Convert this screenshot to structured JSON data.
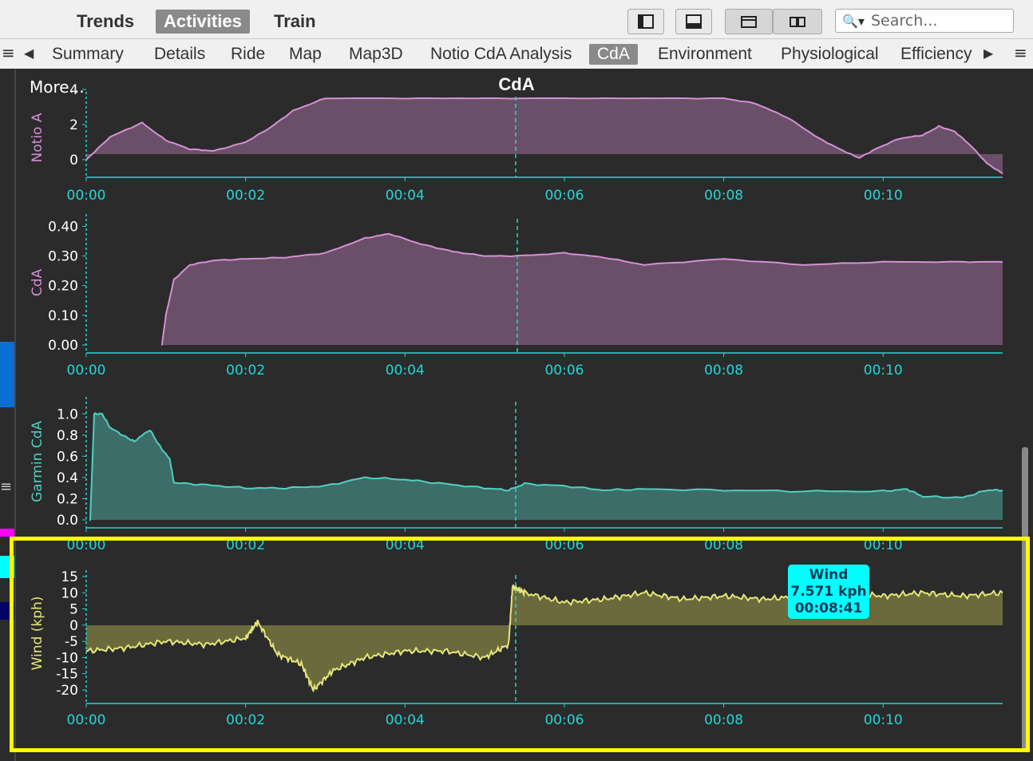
{
  "toolbar": {
    "views": [
      "Trends",
      "Activities",
      "Train"
    ],
    "active_view": "Activities",
    "search_placeholder": "Search..."
  },
  "tabs": {
    "items": [
      "Summary",
      "Details",
      "Ride",
      "Map",
      "Map3D",
      "Notio CdA Analysis",
      "CdA",
      "Environment",
      "Physiological",
      "Efficiency"
    ],
    "active": "CdA"
  },
  "chart": {
    "more_label": "More...",
    "title": "CdA"
  },
  "chart_data": [
    {
      "type": "area",
      "ylabel": "Notio A",
      "x_ticks": [
        "00:00",
        "00:02",
        "00:04",
        "00:06",
        "00:08",
        "00:10"
      ],
      "y_ticks": [
        "0",
        "2",
        "4"
      ],
      "ylim": [
        -1,
        3.5
      ],
      "color": "#d68fd6",
      "x": [
        0,
        0.3,
        0.7,
        1.0,
        1.3,
        1.6,
        2.0,
        2.3,
        2.6,
        3.0,
        4.0,
        5.0,
        6.0,
        7.0,
        8.0,
        8.4,
        8.8,
        9.2,
        9.5,
        9.7,
        9.9,
        10.2,
        10.5,
        10.7,
        10.9,
        11.1,
        11.3,
        11.5
      ],
      "values": [
        0.0,
        1.3,
        2.1,
        1.1,
        0.6,
        0.5,
        1.0,
        1.8,
        2.8,
        3.5,
        3.5,
        3.5,
        3.5,
        3.5,
        3.5,
        3.2,
        2.4,
        1.2,
        0.5,
        0.1,
        0.6,
        1.2,
        1.4,
        1.9,
        1.6,
        0.8,
        -0.2,
        -0.8
      ]
    },
    {
      "type": "area",
      "ylabel": "CdA",
      "x_ticks": [
        "00:00",
        "00:02",
        "00:04",
        "00:06",
        "00:08",
        "00:10"
      ],
      "y_ticks": [
        "0.00",
        "0.10",
        "0.20",
        "0.30",
        "0.40"
      ],
      "ylim": [
        0,
        0.42
      ],
      "color": "#d68fd6",
      "x": [
        0.95,
        1.0,
        1.1,
        1.3,
        1.6,
        2.0,
        2.5,
        3.0,
        3.5,
        3.8,
        4.2,
        4.6,
        5.0,
        5.4,
        6.0,
        6.5,
        7.0,
        8.0,
        9.0,
        10.0,
        11.0,
        11.5
      ],
      "values": [
        0.0,
        0.1,
        0.22,
        0.27,
        0.285,
        0.29,
        0.295,
        0.31,
        0.36,
        0.375,
        0.34,
        0.315,
        0.3,
        0.3,
        0.31,
        0.295,
        0.27,
        0.29,
        0.27,
        0.28,
        0.28,
        0.28
      ]
    },
    {
      "type": "area",
      "ylabel": "Garmin CdA",
      "x_ticks": [
        "00:00",
        "00:02",
        "00:04",
        "00:06",
        "00:08",
        "00:10"
      ],
      "y_ticks": [
        "0.0",
        "0.2",
        "0.4",
        "0.6",
        "0.8",
        "1.0"
      ],
      "ylim": [
        0,
        1.1
      ],
      "color": "#4fd0c0",
      "x": [
        0.05,
        0.1,
        0.2,
        0.3,
        0.5,
        0.6,
        0.8,
        0.9,
        1.05,
        1.1,
        1.5,
        2.0,
        2.5,
        3.0,
        3.5,
        4.0,
        4.5,
        5.0,
        5.3,
        5.5,
        6.0,
        6.5,
        7.0,
        8.0,
        9.0,
        10.0,
        10.3,
        10.5,
        11.0,
        11.3,
        11.5
      ],
      "values": [
        0.0,
        1.0,
        1.0,
        0.87,
        0.78,
        0.74,
        0.85,
        0.72,
        0.57,
        0.35,
        0.33,
        0.3,
        0.3,
        0.32,
        0.4,
        0.38,
        0.34,
        0.3,
        0.28,
        0.34,
        0.32,
        0.28,
        0.29,
        0.28,
        0.27,
        0.27,
        0.29,
        0.22,
        0.21,
        0.28,
        0.28
      ]
    },
    {
      "type": "area",
      "ylabel": "Wind (kph)",
      "x_ticks": [
        "00:00",
        "00:02",
        "00:04",
        "00:06",
        "00:08",
        "00:10"
      ],
      "y_ticks": [
        "-20",
        "-15",
        "-10",
        "-5",
        "0",
        "5",
        "10",
        "15"
      ],
      "ylim": [
        -20,
        15
      ],
      "color": "#e6e67a",
      "x": [
        0,
        0.5,
        1.0,
        1.5,
        2.0,
        2.15,
        2.4,
        2.7,
        2.85,
        3.1,
        3.5,
        4.0,
        4.5,
        5.0,
        5.3,
        5.35,
        5.5,
        6.0,
        6.5,
        7.0,
        7.5,
        8.0,
        8.5,
        9.0,
        9.5,
        10.0,
        10.5,
        11.0,
        11.5
      ],
      "values": [
        -8,
        -7,
        -5,
        -6,
        -4,
        1,
        -9,
        -12,
        -20,
        -14,
        -10,
        -8,
        -8,
        -10,
        -6,
        12,
        10,
        7,
        8,
        10,
        8,
        9,
        8,
        9,
        10,
        9,
        10,
        9,
        10
      ]
    }
  ],
  "tooltip": {
    "series": "Wind",
    "value": "7.571 kph",
    "time": "00:08:41"
  }
}
